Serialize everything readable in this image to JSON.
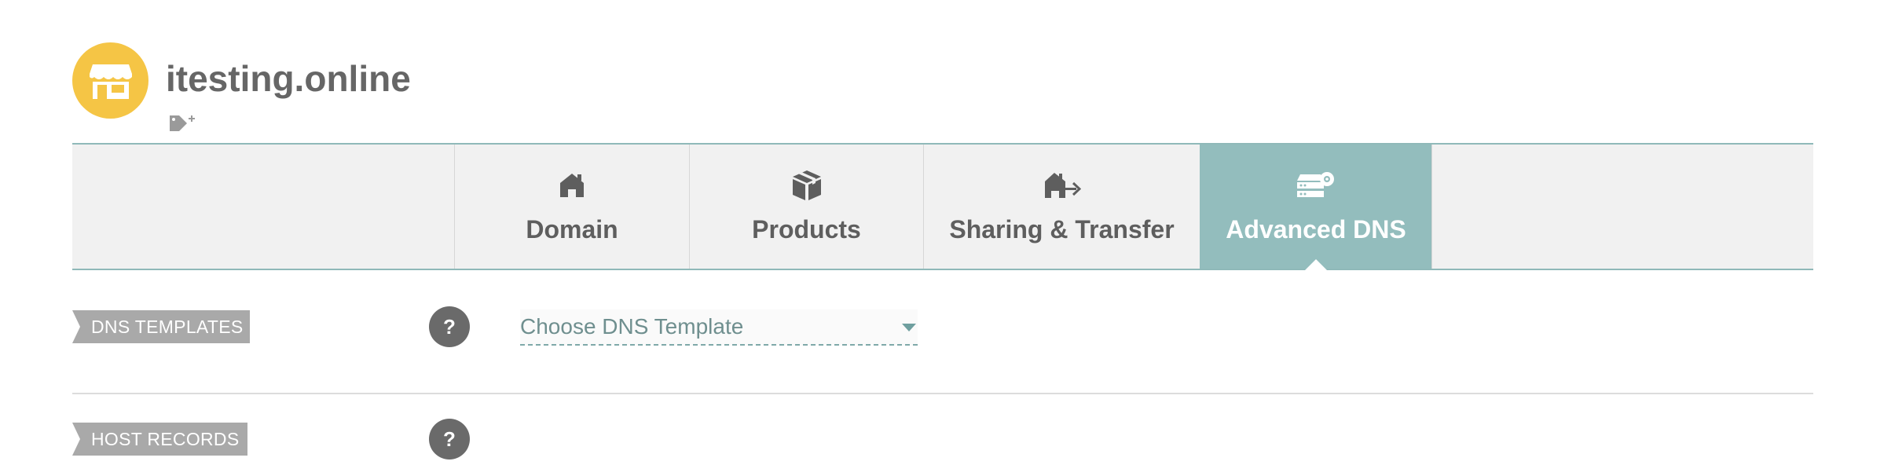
{
  "header": {
    "domain_name": "itesting.online",
    "avatar_icon": "storefront-icon",
    "tag_icon": "add-tag-icon",
    "avatar_color": "#f5c545"
  },
  "tabs": [
    {
      "label": "Domain",
      "icon": "home-icon",
      "active": false
    },
    {
      "label": "Products",
      "icon": "package-icon",
      "active": false
    },
    {
      "label": "Sharing & Transfer",
      "icon": "house-transfer-icon",
      "active": false
    },
    {
      "label": "Advanced DNS",
      "icon": "server-settings-icon",
      "active": true
    }
  ],
  "sections": {
    "dns_templates": {
      "label": "DNS TEMPLATES",
      "help": "?",
      "select_value": "Choose DNS Template"
    },
    "host_records": {
      "label": "HOST RECORDS",
      "help": "?"
    }
  },
  "colors": {
    "accent": "#93bdbd",
    "tab_bar": "#f1f1f1",
    "ribbon": "#a9a9a9"
  }
}
